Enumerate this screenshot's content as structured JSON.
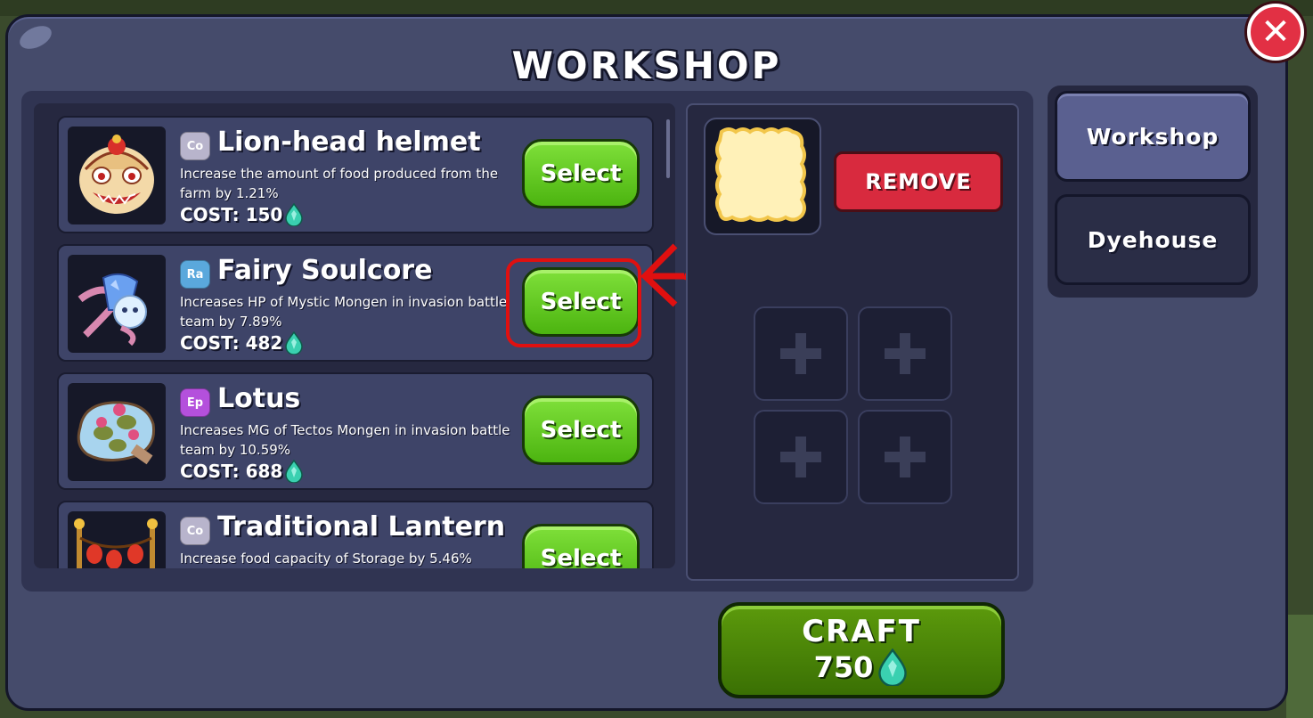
{
  "title": "WORKSHOP",
  "close_label": "✕",
  "items": [
    {
      "name": "Lion-head helmet",
      "rarity": "Co",
      "description": "Increase the amount of food produced from the farm by 1.21%",
      "cost_label": "COST: 150",
      "select_label": "Select"
    },
    {
      "name": "Fairy Soulcore",
      "rarity": "Ra",
      "description": "Increases HP of Mystic Mongen in invasion battle team by 7.89%",
      "cost_label": "COST: 482",
      "select_label": "Select"
    },
    {
      "name": "Lotus",
      "rarity": "Ep",
      "description": "Increases MG of Tectos Mongen in invasion battle team by 10.59%",
      "cost_label": "COST: 688",
      "select_label": "Select"
    },
    {
      "name": "Traditional Lantern",
      "rarity": "Co",
      "description": "Increase food capacity of Storage by 5.46%",
      "cost_label": "",
      "select_label": "Select"
    }
  ],
  "rarity_colors": {
    "Co": "#b8b4cc",
    "Ra": "#5aa8dc",
    "Ep": "#b450dc"
  },
  "craft_panel": {
    "remove_label": "REMOVE",
    "empty_slot_count": 4,
    "slot_icon": "plus-icon"
  },
  "craft_button": {
    "label": "CRAFT",
    "cost": "750"
  },
  "tabs": [
    {
      "label": "Workshop",
      "active": true
    },
    {
      "label": "Dyehouse",
      "active": false
    }
  ],
  "colors": {
    "panel": "#454b6b",
    "select_green": "#5cc41a",
    "remove_red": "#d82a3e",
    "craft_green": "#4a8408",
    "highlight_red": "#e01010",
    "gem": "#3ad0b0"
  }
}
